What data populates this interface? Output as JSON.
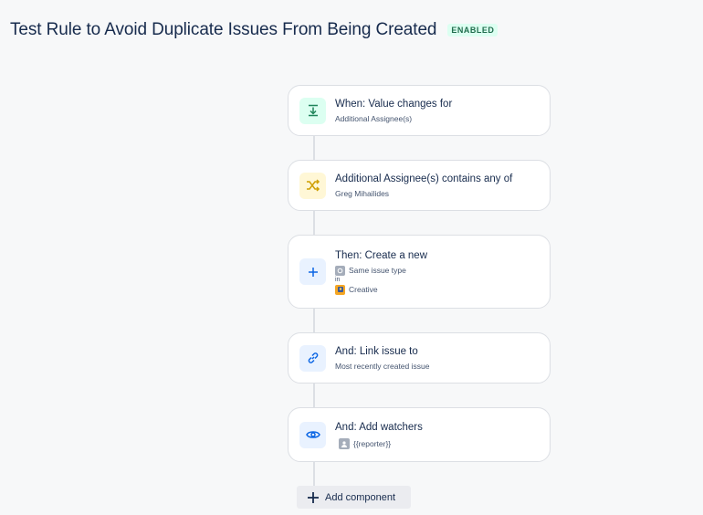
{
  "header": {
    "title": "Test Rule to Avoid Duplicate Issues From Being Created",
    "status": "ENABLED"
  },
  "steps": [
    {
      "title": "When: Value changes for",
      "subtitle": "Additional Assignee(s)",
      "icon": "download-arrow-icon",
      "icon_bg": "#dcfff1",
      "icon_color": "#1f845a"
    },
    {
      "title": "Additional Assignee(s) contains any of",
      "subtitle": "Greg Mihailides",
      "icon": "shuffle-icon",
      "icon_bg": "#fff7d6",
      "icon_color": "#e2b203"
    },
    {
      "title": "Then: Create a new",
      "issue_type": "Same issue type",
      "in_label": "in",
      "project": "Creative",
      "icon": "plus-icon",
      "icon_bg": "#e9f2ff",
      "icon_color": "#0c66e4"
    },
    {
      "title": "And: Link issue to",
      "subtitle": "Most recently created issue",
      "icon": "link-icon",
      "icon_bg": "#e9f2ff",
      "icon_color": "#0c66e4"
    },
    {
      "title": "And: Add watchers",
      "watcher": "{{reporter}}",
      "icon": "eye-icon",
      "icon_bg": "#e9f2ff",
      "icon_color": "#0c66e4"
    }
  ],
  "add_component": {
    "label": "Add component"
  }
}
